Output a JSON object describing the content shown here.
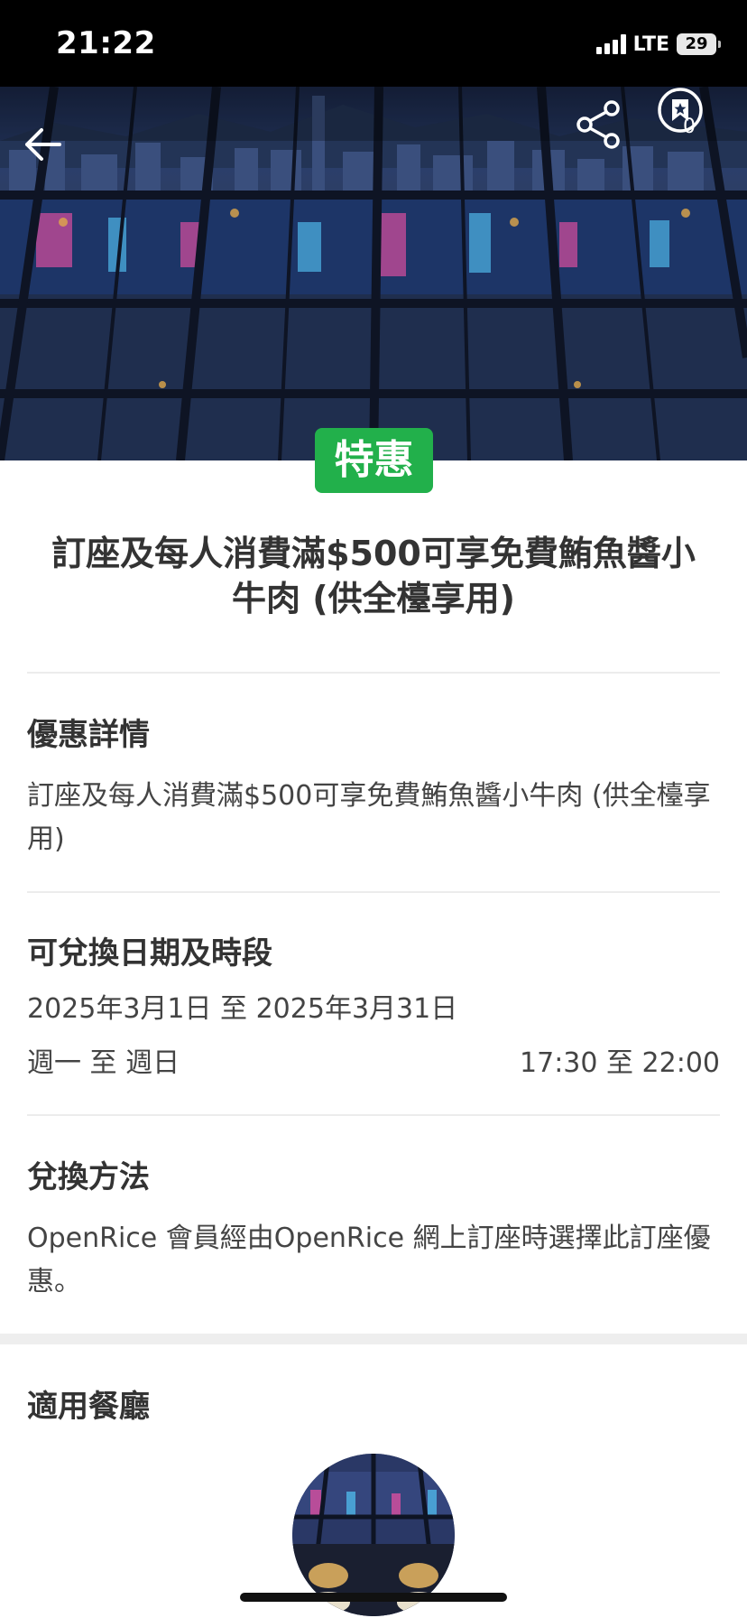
{
  "status_bar": {
    "time": "21:22",
    "network": "LTE",
    "battery": "29"
  },
  "header": {
    "bookmark_count": "0",
    "icons": [
      "back-arrow-icon",
      "share-icon",
      "bookmark-icon"
    ]
  },
  "promo": {
    "badge": "特惠",
    "title": "訂座及每人消費滿$500可享免費鮪魚醬小牛肉 (供全檯享用)",
    "badge_color": "#22b04b"
  },
  "sections": {
    "details": {
      "heading": "優惠詳情",
      "text": "訂座及每人消費滿$500可享免費鮪魚醬小牛肉 (供全檯享用)"
    },
    "redeem_period": {
      "heading": "可兌換日期及時段",
      "date_range": "2025年3月1日 至 2025年3月31日",
      "days": "週一 至 週日",
      "hours": "17:30 至 22:00"
    },
    "method": {
      "heading": "兌換方法",
      "text": "OpenRice 會員經由OpenRice 網上訂座時選擇此訂座優惠。"
    },
    "restaurants": {
      "heading": "適用餐廳"
    }
  }
}
